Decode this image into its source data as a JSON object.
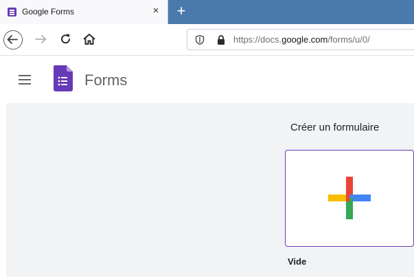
{
  "tab": {
    "title": "Google Forms",
    "close_glyph": "×",
    "new_tab_glyph": "+"
  },
  "nav": {
    "back_icon": "back-arrow-icon",
    "forward_icon": "forward-arrow-icon",
    "reload_icon": "reload-icon",
    "home_icon": "home-icon",
    "url_prefix": "https://docs.",
    "url_domain": "google.com",
    "url_path": "/forms/u/0/"
  },
  "header": {
    "app_title": "Forms",
    "menu_icon": "hamburger-menu-icon",
    "logo_icon": "google-forms-logo-icon"
  },
  "main": {
    "section_title": "Créer un formulaire",
    "blank_label": "Vide",
    "plus_icon": "multicolor-plus-icon"
  },
  "colors": {
    "forms_purple": "#673ab7",
    "tabstrip_blue": "#4a7aad",
    "plus_red": "#ea4335",
    "plus_blue": "#4285f4",
    "plus_green": "#34a853",
    "plus_yellow": "#fbbc04"
  }
}
